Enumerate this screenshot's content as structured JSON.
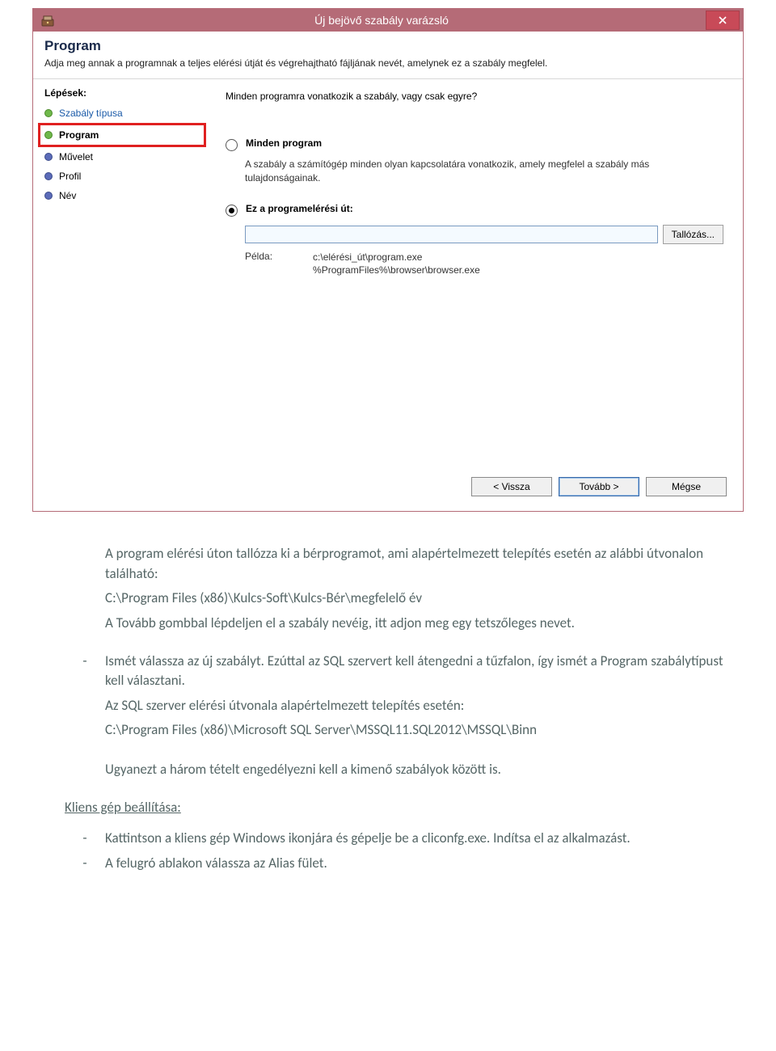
{
  "dialog": {
    "title": "Új bejövő szabály varázsló",
    "header_heading": "Program",
    "header_desc": "Adja meg annak a programnak a teljes elérési útját és végrehajtható fájljának nevét, amelynek ez a szabály megfelel.",
    "steps_label": "Lépések:",
    "steps": [
      {
        "label": "Szabály típusa",
        "link": true
      },
      {
        "label": "Program",
        "current": true
      },
      {
        "label": "Művelet"
      },
      {
        "label": "Profil"
      },
      {
        "label": "Név"
      }
    ],
    "question": "Minden programra vonatkozik a szabály, vagy csak egyre?",
    "opt_all_label": "Minden program",
    "opt_all_desc": "A szabály a számítógép minden olyan kapcsolatára vonatkozik, amely megfelel a szabály más tulajdonságainak.",
    "opt_path_label": "Ez a programelérési út:",
    "path_value": "",
    "browse_label": "Tallózás...",
    "example_label": "Példa:",
    "example_paths_line1": "c:\\elérési_út\\program.exe",
    "example_paths_line2": "%ProgramFiles%\\browser\\browser.exe",
    "btn_back": "< Vissza",
    "btn_next": "Tovább >",
    "btn_cancel": "Mégse"
  },
  "doc": {
    "p1_l1": "A program elérési úton tallózza ki a bérprogramot, ami alapértelmezett telepítés esetén az alábbi útvonalon található:",
    "p1_path": "C:\\Program Files (x86)\\Kulcs-Soft\\Kulcs-Bér\\megfelelő év",
    "p1_l3": "A Tovább gombbal lépdeljen el a szabály nevéig, itt adjon meg egy tetszőleges nevet.",
    "b1_l1": "Ismét válassza az új szabályt. Ezúttal az SQL szervert kell átengedni a tűzfalon, így ismét a Program szabálytípust kell választani.",
    "b1_l2": "Az SQL szerver elérési útvonala alapértelmezett telepítés esetén:",
    "b1_path": "C:\\Program Files (x86)\\Microsoft SQL Server\\MSSQL11.SQL2012\\MSSQL\\Binn",
    "p_out": "Ugyanezt a három tételt engedélyezni kell a kimenő szabályok között is.",
    "section": "Kliens gép beállítása:",
    "k1": "Kattintson a kliens gép Windows ikonjára és gépelje be a cliconfg.exe. Indítsa el az alkalmazást.",
    "k2": "A felugró ablakon válassza az Alias fület."
  }
}
